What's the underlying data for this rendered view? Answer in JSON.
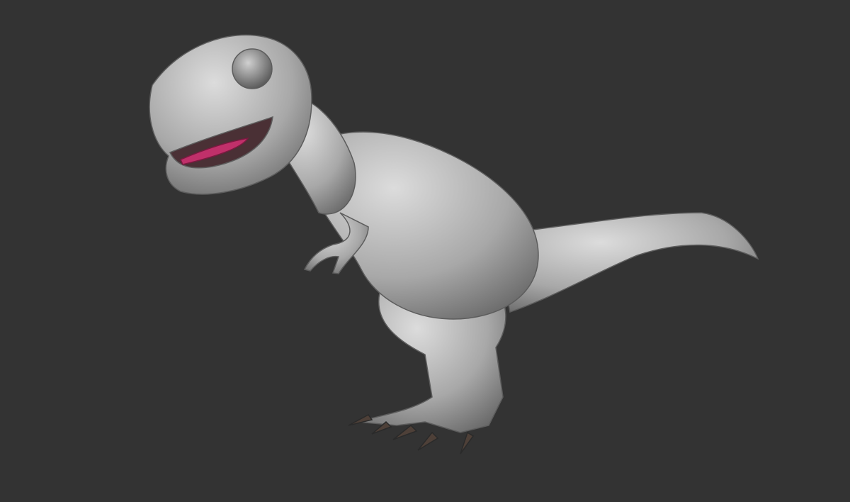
{
  "scene": {
    "subject": "t-rex-sculpt",
    "colors": {
      "background": "#333333",
      "skin": "#b9b9b9",
      "skin_shadow": "#7a7a7a",
      "tongue": "#c0306a",
      "claws": "#5a4a40",
      "teeth": "#e8e2d6",
      "eye": "#8a8a8a"
    }
  }
}
